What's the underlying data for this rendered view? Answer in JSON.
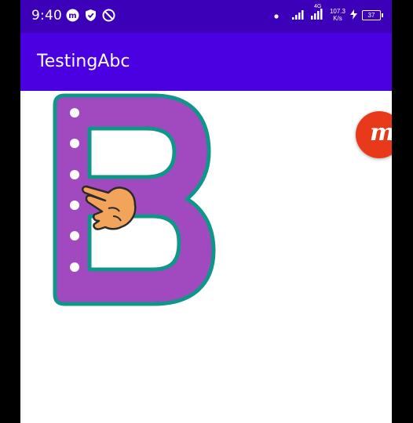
{
  "status_bar": {
    "time": "9:40",
    "net_speed_value": "107.3",
    "net_speed_unit": "K/s",
    "network_type": "4G",
    "battery": "37",
    "left_icons": [
      "app-m-icon",
      "shield-check-icon",
      "no-disturb-icon"
    ],
    "right_icons": [
      "dot-icon",
      "signal-bars-icon",
      "signal-4g-icon",
      "charging-bolt-icon",
      "battery-icon"
    ],
    "bg_color": "#3b00b8"
  },
  "app_bar": {
    "title": "TestingAbc",
    "bg_color": "#4a00e0"
  },
  "letter": {
    "glyph": "B",
    "fill_color": "#a14ac0",
    "outline_color": "#0f9688",
    "guide_dots": 6,
    "pointer_icon": "hand-pointer-icon"
  },
  "floating_button": {
    "label": "m",
    "color": "#e8391a"
  }
}
